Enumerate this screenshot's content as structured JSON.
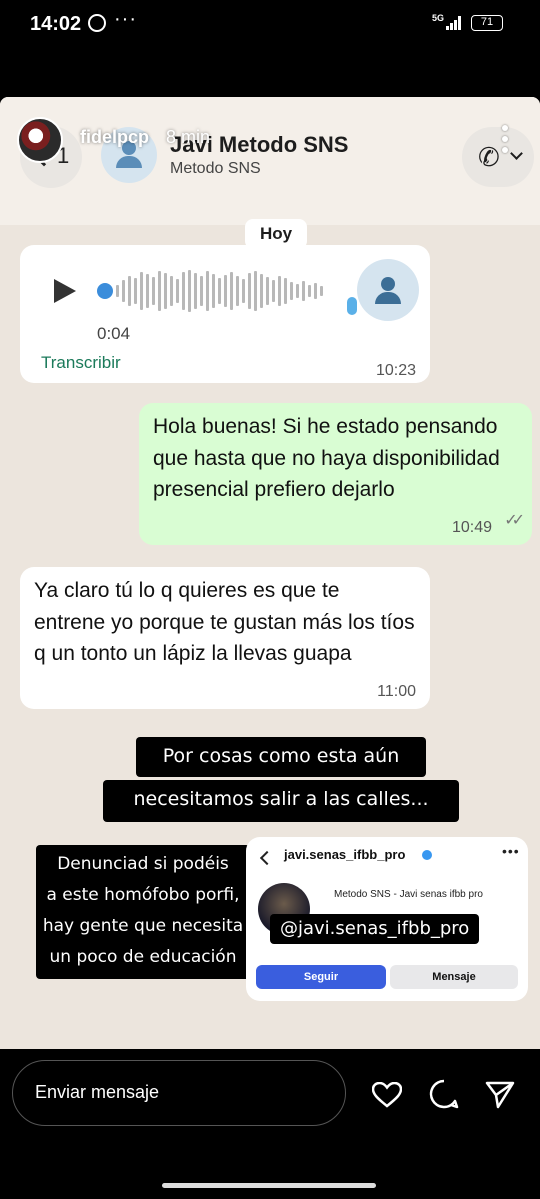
{
  "status_bar": {
    "time": "14:02",
    "network": "5G",
    "battery": "71"
  },
  "story": {
    "username": "fidelpcp",
    "posted_ago": "8 min"
  },
  "chat": {
    "header": {
      "back_count": "1",
      "contact_name": "Javi Metodo SNS",
      "contact_subtitle": "Metodo SNS"
    },
    "date_chip": "Hoy",
    "voice_message": {
      "duration": "0:04",
      "transcribe_label": "Transcribir",
      "time": "10:23"
    },
    "messages": [
      {
        "direction": "outgoing",
        "text": "Hola buenas! Si he estado pensando que hasta que no haya disponibilidad presencial prefiero dejarlo",
        "time": "10:49",
        "status": "read"
      },
      {
        "direction": "incoming",
        "text": "Ya claro tú lo q quieres es que te entrene yo porque te gustan más los tíos q un tonto un lápiz la llevas guapa",
        "time": "11:00"
      }
    ]
  },
  "captions": {
    "line1": "Por cosas como esta aún",
    "line2": "necesitamos salir a las calles...",
    "side_lines": [
      "Denunciad si podéis",
      "a este homófobo porfi,",
      "hay gente que necesita",
      "un poco de educación"
    ]
  },
  "profile_card": {
    "username": "javi.senas_ifbb_pro",
    "bio": "Metodo SNS - Javi senas ifbb pro",
    "mention": "@javi.senas_ifbb_pro",
    "follow_label": "Seguir",
    "message_label": "Mensaje",
    "accent_color": "#3a5ede"
  },
  "reply_bar": {
    "placeholder": "Enviar mensaje"
  },
  "colors": {
    "outgoing_bubble": "#d9fdd3",
    "incoming_bubble": "#ffffff",
    "chat_background": "#ece5dd",
    "transcribe_link": "#1b7a5a"
  }
}
